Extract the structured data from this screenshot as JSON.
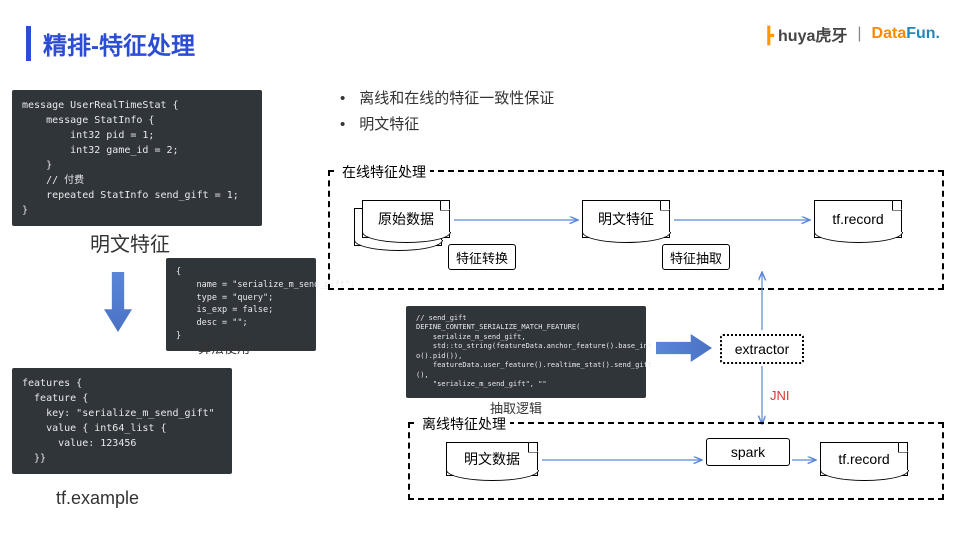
{
  "title": "精排-特征处理",
  "logos": {
    "huya": "huya虎牙",
    "sep": "|",
    "datafun": "DataFun."
  },
  "bullets": [
    "离线和在线的特征一致性保证",
    "明文特征"
  ],
  "left": {
    "code1": "message UserRealTimeStat {\n    message StatInfo {\n        int32 pid = 1;\n        int32 game_id = 2;\n    }\n    // 付费\n    repeated StatInfo send_gift = 1;\n}",
    "label1": "明文特征",
    "code2": "{\n    name = \"serialize_m_send_gift\";\n    type = \"query\";\n    is_exp = false;\n    desc = \"\";\n}",
    "label2": "算法使用",
    "code3": "features {\n  feature {\n    key: \"serialize_m_send_gift\"\n    value { int64_list {\n      value: 123456\n  }}\n",
    "label3": "tf.example"
  },
  "online": {
    "title": "在线特征处理",
    "raw": "原始数据",
    "transform": "特征转换",
    "plaintext": "明文特征",
    "extract": "特征抽取",
    "tfrecord": "tf.record"
  },
  "middle": {
    "code": "// send_gift\nDEFINE_CONTENT_SERIALIZE_MATCH_FEATURE(\n    serialize_m_send_gift,\n    std::to_string(featureData.anchor_feature().base_inf\no().pid()),\n    featureData.user_feature().realtime_stat().send_gift\n(),\n    \"serialize_m_send_gift\", \"\"",
    "label": "抽取逻辑",
    "extractor": "extractor",
    "jni": "JNI"
  },
  "offline": {
    "title": "离线特征处理",
    "plain": "明文数据",
    "spark": "spark",
    "tfrecord": "tf.record"
  }
}
